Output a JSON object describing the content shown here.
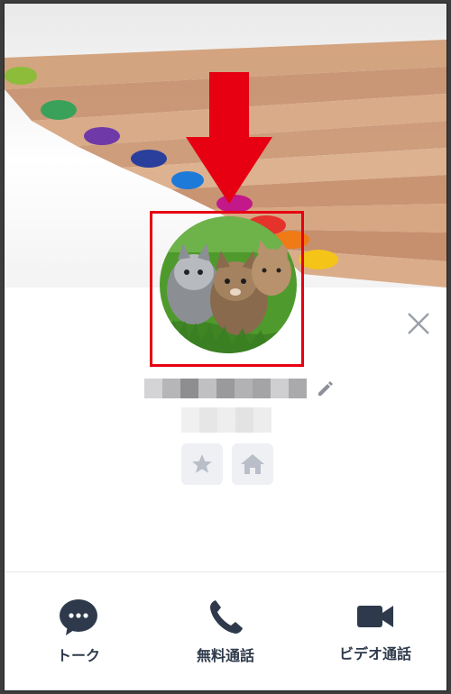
{
  "profile": {
    "cover_description_icon": "colored-pencils-cover",
    "avatar_icon": "kittens-avatar",
    "highlight_color": "#e60012"
  },
  "icons": {
    "close": "close-icon",
    "edit": "pencil-icon",
    "favorite": "star-icon",
    "home": "home-icon",
    "talk": "chat-bubble-icon",
    "call": "phone-icon",
    "video": "video-camera-icon"
  },
  "actions": {
    "talk_label": "トーク",
    "free_call_label": "無料通話",
    "video_call_label": "ビデオ通話"
  },
  "colors": {
    "icon_dark": "#2e3a4c",
    "icon_gray": "#b9bec9",
    "button_bg": "#eef0f4",
    "annotation_red": "#e60012"
  }
}
